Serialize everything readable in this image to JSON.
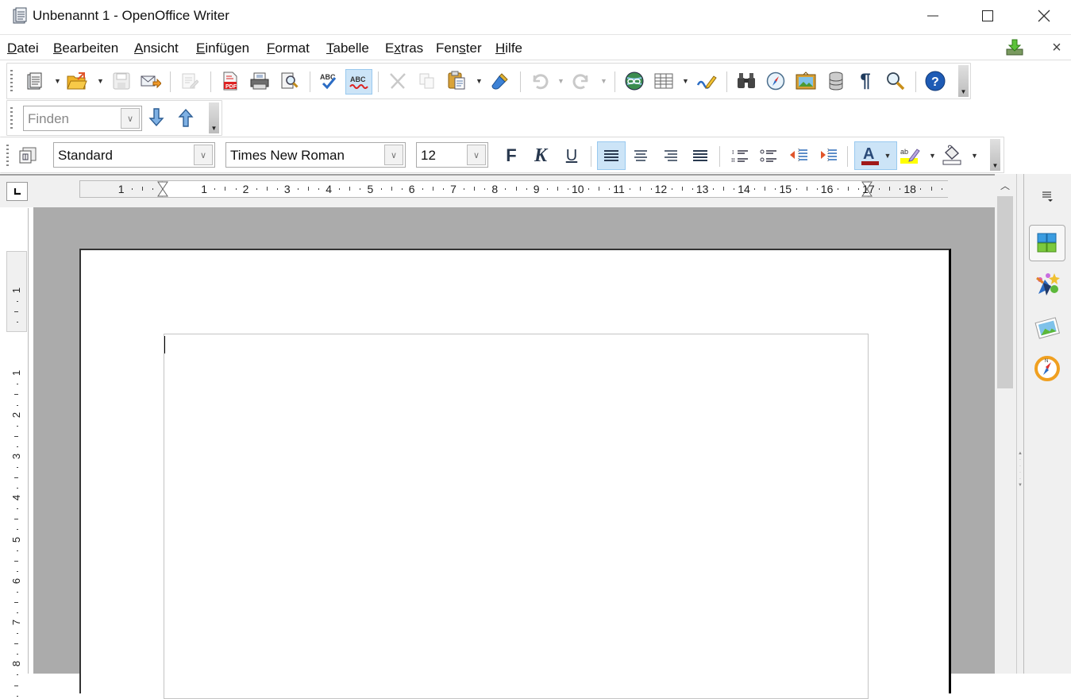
{
  "window": {
    "title": "Unbenannt 1 - OpenOffice Writer",
    "controls": {
      "minimize": "minimize-icon",
      "maximize": "maximize-icon",
      "close": "close-icon"
    }
  },
  "menubar": {
    "items": [
      {
        "label": "Datei",
        "mnemonic": "D"
      },
      {
        "label": "Bearbeiten",
        "mnemonic": "B"
      },
      {
        "label": "Ansicht",
        "mnemonic": "A"
      },
      {
        "label": "Einfügen",
        "mnemonic": "E"
      },
      {
        "label": "Format",
        "mnemonic": "F"
      },
      {
        "label": "Tabelle",
        "mnemonic": "T"
      },
      {
        "label": "Extras",
        "mnemonic": "x"
      },
      {
        "label": "Fenster",
        "mnemonic": "s"
      },
      {
        "label": "Hilfe",
        "mnemonic": "H"
      }
    ],
    "update_icon": "update-download-icon",
    "close_doc_label": "×"
  },
  "standard_toolbar": {
    "items": [
      "new-document",
      "open",
      "save",
      "email-document",
      "edit-file",
      "export-pdf",
      "print",
      "page-preview",
      "spellcheck",
      "auto-spellcheck",
      "cut",
      "copy",
      "paste",
      "clone-formatting",
      "undo",
      "redo",
      "hyperlink",
      "table",
      "show-draw-functions",
      "find-replace",
      "navigator",
      "gallery",
      "data-sources",
      "formatting-marks",
      "zoom",
      "help"
    ],
    "auto_spellcheck_active": true
  },
  "find_toolbar": {
    "placeholder": "Finden",
    "value": "",
    "next_icon": "arrow-down-icon",
    "prev_icon": "arrow-up-icon"
  },
  "formatting_toolbar": {
    "paragraph_style": "Standard",
    "font_name": "Times New Roman",
    "font_size": "12",
    "bold_label": "F",
    "italic_label": "K",
    "underline_label": "U",
    "alignment_active": "left",
    "font_color": "#a01818",
    "highlight_color": "#ffff00"
  },
  "ruler": {
    "horizontal_labels": [
      "1",
      "1",
      "2",
      "3",
      "4",
      "5",
      "6",
      "7",
      "8",
      "9",
      "10",
      "11",
      "12",
      "13",
      "14",
      "15",
      "16",
      "17",
      "18"
    ],
    "vertical_labels": [
      "1",
      "1",
      "2",
      "3",
      "4",
      "5",
      "6",
      "7",
      "8"
    ],
    "tab_type": "left-tab"
  },
  "sidebar": {
    "menu_icon": "sidebar-menu-icon",
    "items": [
      {
        "name": "properties",
        "selected": true
      },
      {
        "name": "styles-formatting",
        "selected": false
      },
      {
        "name": "gallery",
        "selected": false
      },
      {
        "name": "navigator",
        "selected": false
      }
    ]
  },
  "document": {
    "content": ""
  }
}
